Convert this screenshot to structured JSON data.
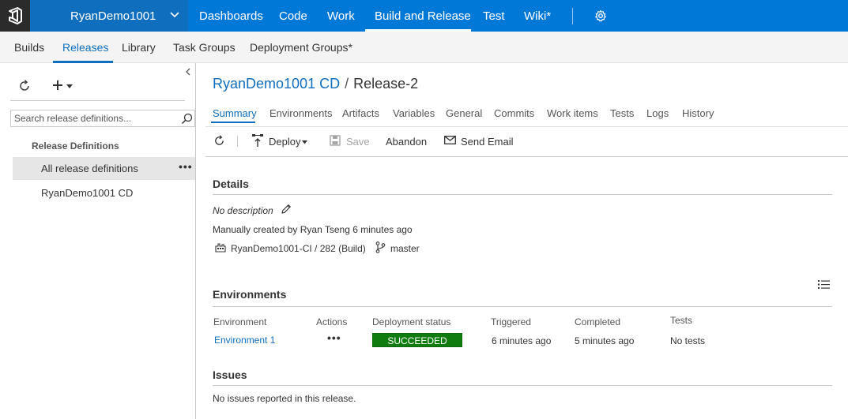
{
  "topbar": {
    "project_name": "RyanDemo1001",
    "nav": [
      {
        "label": "Dashboards"
      },
      {
        "label": "Code"
      },
      {
        "label": "Work"
      },
      {
        "label": "Build and Release"
      },
      {
        "label": "Test"
      },
      {
        "label": "Wiki*"
      }
    ],
    "active_nav": "Build and Release",
    "icons": [
      "vsts-logo-icon",
      "chevron-down-icon",
      "gear-icon"
    ]
  },
  "subnav": {
    "items": [
      {
        "label": "Builds"
      },
      {
        "label": "Releases"
      },
      {
        "label": "Library"
      },
      {
        "label": "Task Groups"
      },
      {
        "label": "Deployment Groups*"
      }
    ],
    "active": "Releases"
  },
  "left_panel": {
    "search_placeholder": "Search release definitions...",
    "heading": "Release Definitions",
    "items": [
      {
        "label": "All release definitions",
        "selected": true
      },
      {
        "label": "RyanDemo1001 CD",
        "selected": false
      }
    ],
    "more_label": "•••"
  },
  "main": {
    "breadcrumb": {
      "definition": "RyanDemo1001 CD",
      "separator": "/",
      "release": "Release-2"
    },
    "tabs": [
      {
        "label": "Summary"
      },
      {
        "label": "Environments"
      },
      {
        "label": "Artifacts"
      },
      {
        "label": "Variables"
      },
      {
        "label": "General"
      },
      {
        "label": "Commits"
      },
      {
        "label": "Work items"
      },
      {
        "label": "Tests"
      },
      {
        "label": "Logs"
      },
      {
        "label": "History"
      }
    ],
    "active_tab": "Summary",
    "toolbar": {
      "deploy": "Deploy",
      "save": "Save",
      "abandon": "Abandon",
      "send_email": "Send Email"
    },
    "details": {
      "title": "Details",
      "description": "No description",
      "created": "Manually created by Ryan Tseng 6 minutes ago",
      "artifact": "RyanDemo1001-CI / 282 (Build)",
      "branch": "master"
    },
    "environments": {
      "title": "Environments",
      "columns": [
        "Environment",
        "Actions",
        "Deployment status",
        "Triggered",
        "Completed",
        "Tests"
      ],
      "rows": [
        {
          "environment": "Environment 1",
          "actions": "•••",
          "status": "SUCCEEDED",
          "triggered": "6 minutes ago",
          "completed": "5 minutes ago",
          "tests": "No tests"
        }
      ]
    },
    "issues": {
      "title": "Issues",
      "text": "No issues reported in this release."
    }
  },
  "colors": {
    "brand_blue": "#0078d7",
    "project_blue": "#106ebe",
    "succeeded_green": "#107c10",
    "logo_bg": "#2b2b2b"
  }
}
